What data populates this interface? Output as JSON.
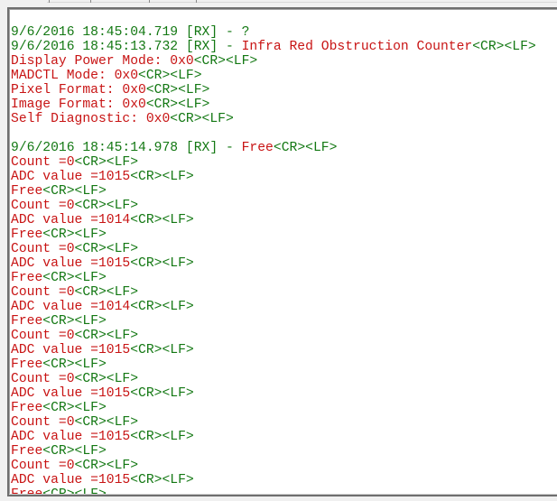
{
  "colors": {
    "timestamp_green": "#137813",
    "data_red": "#c81414",
    "background": "#f0f0f0",
    "text_area": "#ffffff"
  },
  "log": {
    "lines": [
      {
        "green": "9/6/2016 18:45:04.719 [RX] - ?",
        "red": "",
        "eol": ""
      },
      {
        "green": "9/6/2016 18:45:13.732 [RX] - ",
        "red": "Infra Red Obstruction Counter",
        "eol": "<CR><LF>"
      },
      {
        "green": "",
        "red": "Display Power Mode: 0x0",
        "eol": "<CR><LF>"
      },
      {
        "green": "",
        "red": "MADCTL Mode: 0x0",
        "eol": "<CR><LF>"
      },
      {
        "green": "",
        "red": "Pixel Format: 0x0",
        "eol": "<CR><LF>"
      },
      {
        "green": "",
        "red": "Image Format: 0x0",
        "eol": "<CR><LF>"
      },
      {
        "green": "",
        "red": "Self Diagnostic: 0x0",
        "eol": "<CR><LF>"
      },
      {
        "green": "",
        "red": "",
        "eol": ""
      },
      {
        "green": "9/6/2016 18:45:14.978 [RX] - ",
        "red": "Free",
        "eol": "<CR><LF>"
      },
      {
        "green": "",
        "red": "Count =0",
        "eol": "<CR><LF>"
      },
      {
        "green": "",
        "red": "ADC value =1015",
        "eol": "<CR><LF>"
      },
      {
        "green": "",
        "red": "Free",
        "eol": "<CR><LF>"
      },
      {
        "green": "",
        "red": "Count =0",
        "eol": "<CR><LF>"
      },
      {
        "green": "",
        "red": "ADC value =1014",
        "eol": "<CR><LF>"
      },
      {
        "green": "",
        "red": "Free",
        "eol": "<CR><LF>"
      },
      {
        "green": "",
        "red": "Count =0",
        "eol": "<CR><LF>"
      },
      {
        "green": "",
        "red": "ADC value =1015",
        "eol": "<CR><LF>"
      },
      {
        "green": "",
        "red": "Free",
        "eol": "<CR><LF>"
      },
      {
        "green": "",
        "red": "Count =0",
        "eol": "<CR><LF>"
      },
      {
        "green": "",
        "red": "ADC value =1014",
        "eol": "<CR><LF>"
      },
      {
        "green": "",
        "red": "Free",
        "eol": "<CR><LF>"
      },
      {
        "green": "",
        "red": "Count =0",
        "eol": "<CR><LF>"
      },
      {
        "green": "",
        "red": "ADC value =1015",
        "eol": "<CR><LF>"
      },
      {
        "green": "",
        "red": "Free",
        "eol": "<CR><LF>"
      },
      {
        "green": "",
        "red": "Count =0",
        "eol": "<CR><LF>"
      },
      {
        "green": "",
        "red": "ADC value =1015",
        "eol": "<CR><LF>"
      },
      {
        "green": "",
        "red": "Free",
        "eol": "<CR><LF>"
      },
      {
        "green": "",
        "red": "Count =0",
        "eol": "<CR><LF>"
      },
      {
        "green": "",
        "red": "ADC value =1015",
        "eol": "<CR><LF>"
      },
      {
        "green": "",
        "red": "Free",
        "eol": "<CR><LF>"
      },
      {
        "green": "",
        "red": "Count =0",
        "eol": "<CR><LF>"
      },
      {
        "green": "",
        "red": "ADC value =1015",
        "eol": "<CR><LF>"
      },
      {
        "green": "",
        "red": "Free",
        "eol": "<CR><LF>"
      }
    ]
  }
}
